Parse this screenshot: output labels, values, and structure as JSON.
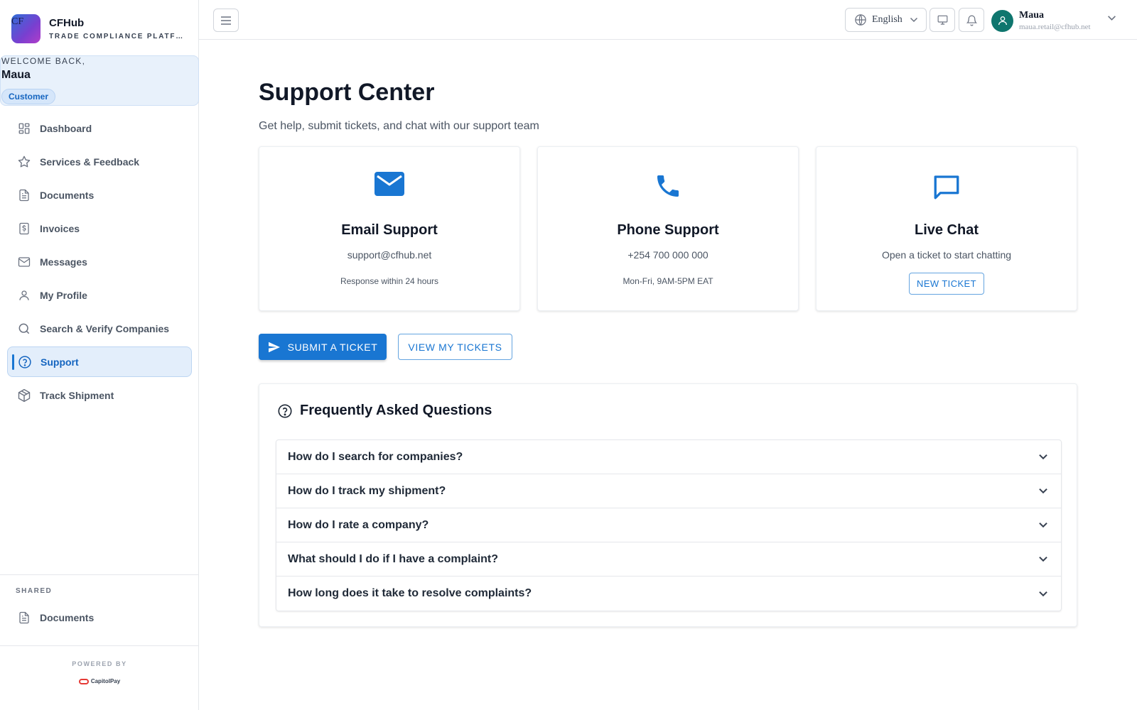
{
  "brand": {
    "logo_text": "CF",
    "name": "CFHub",
    "subtitle": "TRADE COMPLIANCE PLATFORM"
  },
  "welcome": {
    "label": "WELCOME BACK,",
    "name": "Maua",
    "role": "Customer"
  },
  "sidebar": {
    "items": [
      {
        "label": "Dashboard",
        "icon": "dashboard-icon",
        "active": false
      },
      {
        "label": "Services & Feedback",
        "icon": "star-icon",
        "active": false
      },
      {
        "label": "Documents",
        "icon": "document-icon",
        "active": false
      },
      {
        "label": "Invoices",
        "icon": "invoice-icon",
        "active": false
      },
      {
        "label": "Messages",
        "icon": "mail-icon",
        "active": false
      },
      {
        "label": "My Profile",
        "icon": "user-icon",
        "active": false
      },
      {
        "label": "Search & Verify Companies",
        "icon": "search-icon",
        "active": false
      },
      {
        "label": "Support",
        "icon": "help-circle-icon",
        "active": true
      },
      {
        "label": "Track Shipment",
        "icon": "package-icon",
        "active": false
      }
    ],
    "shared_label": "SHARED",
    "shared_items": [
      {
        "label": "Documents",
        "icon": "document-icon"
      }
    ],
    "powered_by": "POWERED BY",
    "powered_logo": "CapitolPay"
  },
  "topbar": {
    "language": "English",
    "user_name": "Maua",
    "user_email": "maua.retail@cfhub.net"
  },
  "main": {
    "title": "Support Center",
    "subtitle": "Get help, submit tickets, and chat with our support team",
    "cards": [
      {
        "icon": "email-icon",
        "title": "Email Support",
        "line1": "support@cfhub.net",
        "line2": "Response within 24 hours"
      },
      {
        "icon": "phone-icon",
        "title": "Phone Support",
        "line1": "+254 700 000 000",
        "line2": "Mon-Fri, 9AM-5PM EAT"
      },
      {
        "icon": "chat-icon",
        "title": "Live Chat",
        "line1": "Open a ticket to start chatting",
        "button": "NEW TICKET"
      }
    ],
    "submit_ticket": "SUBMIT A TICKET",
    "view_tickets": "VIEW MY TICKETS",
    "faq": {
      "title": "Frequently Asked Questions",
      "questions": [
        "How do I search for companies?",
        "How do I track my shipment?",
        "How do I rate a company?",
        "What should I do if I have a complaint?",
        "How long does it take to resolve complaints?"
      ]
    }
  },
  "colors": {
    "accent": "#1976d2",
    "active_bg": "#e3eefb",
    "avatar": "#0f766e"
  }
}
